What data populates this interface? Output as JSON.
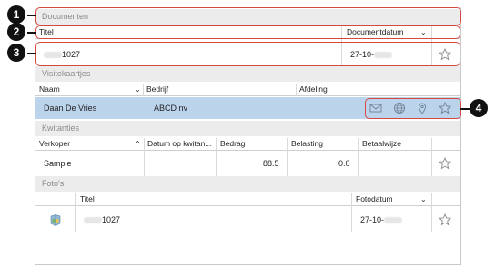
{
  "documents": {
    "section_title": "Documenten",
    "col_titel": "Titel",
    "col_date": "Documentdatum",
    "row_title_suffix": "1027",
    "row_date_prefix": "27-10-"
  },
  "business_cards": {
    "section_title": "Visitekaartjes",
    "col_naam": "Naam",
    "col_bedrijf": "Bedrijf",
    "col_afdeling": "Afdeling",
    "row_name": "Daan De Vries",
    "row_company": "ABCD nv"
  },
  "receipts": {
    "section_title": "Kwitanties",
    "col_verkoper": "Verkoper",
    "col_datum": "Datum op kwitan...",
    "col_bedrag": "Bedrag",
    "col_belasting": "Belasting",
    "col_betaalwijze": "Betaalwijze",
    "row_seller": "Sample",
    "row_amount": "88.5",
    "row_tax": "0.0"
  },
  "photos": {
    "section_title": "Foto's",
    "col_titel": "Titel",
    "col_date": "Fotodatum",
    "row_title_suffix": "1027",
    "row_date_prefix": "27-10-"
  },
  "callouts": [
    "1",
    "2",
    "3",
    "4"
  ],
  "icons": {
    "chevron": "⌄",
    "chevron_up": "⌃"
  },
  "colors": {
    "highlight_row": "#bcd3ec",
    "annotation_red": "#d6473f",
    "callout_black": "#111111"
  }
}
